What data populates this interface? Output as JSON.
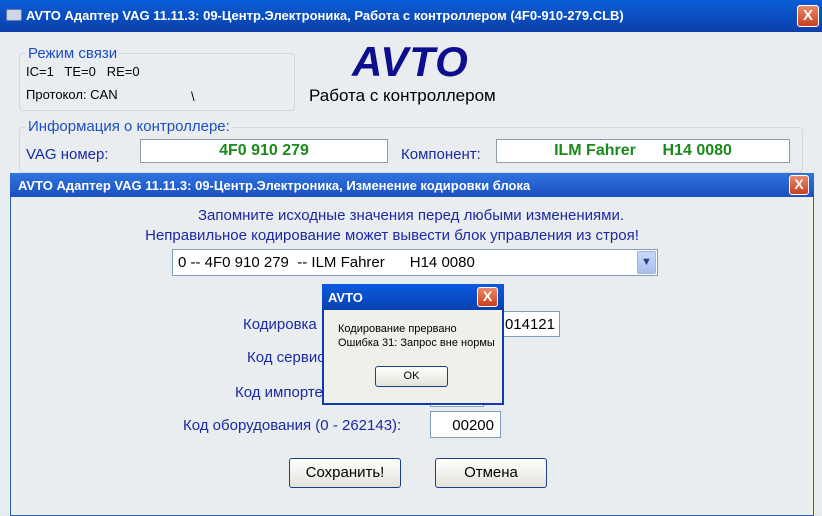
{
  "main_window": {
    "title": "AVTO Адаптер VAG 11.11.3: 09-Центр.Электроника,  Работа с контроллером (4F0-910-279.CLB)",
    "close_label": "X",
    "connection": {
      "group_label": "Режим связи",
      "status_line": "IC=1   TE=0   RE=0",
      "protocol": "Протокол: CAN",
      "spinner": "\\"
    },
    "logo": "AVTO",
    "subtitle": "Работа с контроллером",
    "info": {
      "group_label": "Информация о контроллере:",
      "vag_label": "VAG номер:",
      "vag_value": "4F0 910 279",
      "component_label": "Компонент:",
      "component_value": "ILM Fahrer      H14 0080"
    }
  },
  "dialog": {
    "title": "AVTO Адаптер VAG 11.11.3: 09-Центр.Электроника,  Изменение кодировки блока",
    "close_label": "X",
    "notice_line1": "Запомните исходные значения перед любыми изменениями.",
    "notice_line2": "Неправильное кодирование может вывести блок управления из строя!",
    "selected_option": "0 -- 4F0 910 279  -- ILM Fahrer      H14 0080",
    "coding_label": "Кодировка",
    "coding_value": "014121",
    "service_label": "Код сервис",
    "importer_label": "Код импорте",
    "equipment_label": "Код оборудования (0 - 262143):",
    "equipment_value": "00200",
    "save_button": "Сохранить!",
    "cancel_button": "Отмена"
  },
  "message_box": {
    "title": "AVTO",
    "close_label": "X",
    "line1": "Кодирование прервано",
    "line2": "Ошибка 31: Запрос вне нормы",
    "ok_button": "OK"
  },
  "colors": {
    "titlebar": "#0a4fc8",
    "accent_text": "#1b2aa0",
    "value_green": "#1b8a1b",
    "logo": "#0d0d8f",
    "close_button": "#d9572f"
  }
}
